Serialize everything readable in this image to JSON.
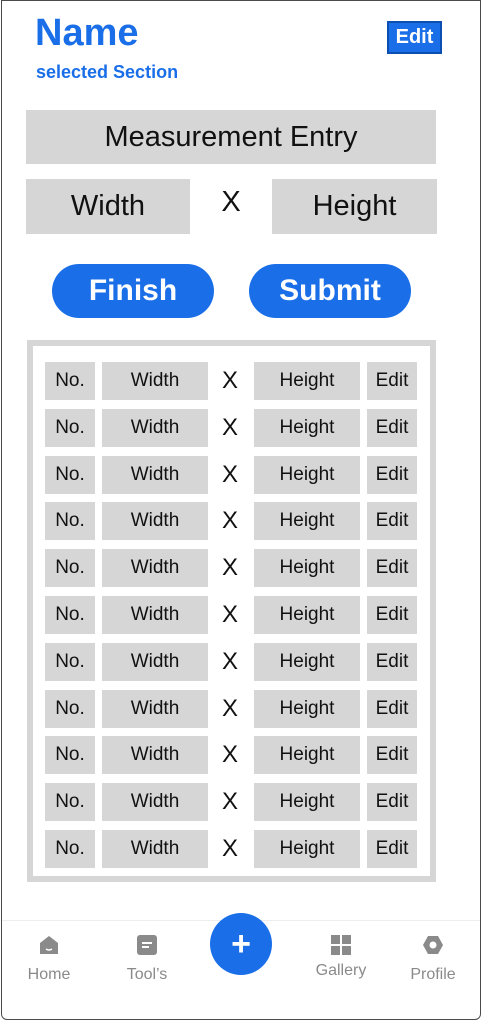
{
  "header": {
    "title": "Name",
    "subtitle": "selected Section",
    "edit_label": "Edit"
  },
  "entry": {
    "title": "Measurement Entry",
    "width_label": "Width",
    "x_label": "X",
    "height_label": "Height"
  },
  "actions": {
    "finish_label": "Finish",
    "submit_label": "Submit"
  },
  "table": {
    "rows": [
      {
        "no": "No.",
        "width": "Width",
        "x": "X",
        "height": "Height",
        "edit": "Edit"
      },
      {
        "no": "No.",
        "width": "Width",
        "x": "X",
        "height": "Height",
        "edit": "Edit"
      },
      {
        "no": "No.",
        "width": "Width",
        "x": "X",
        "height": "Height",
        "edit": "Edit"
      },
      {
        "no": "No.",
        "width": "Width",
        "x": "X",
        "height": "Height",
        "edit": "Edit"
      },
      {
        "no": "No.",
        "width": "Width",
        "x": "X",
        "height": "Height",
        "edit": "Edit"
      },
      {
        "no": "No.",
        "width": "Width",
        "x": "X",
        "height": "Height",
        "edit": "Edit"
      },
      {
        "no": "No.",
        "width": "Width",
        "x": "X",
        "height": "Height",
        "edit": "Edit"
      },
      {
        "no": "No.",
        "width": "Width",
        "x": "X",
        "height": "Height",
        "edit": "Edit"
      },
      {
        "no": "No.",
        "width": "Width",
        "x": "X",
        "height": "Height",
        "edit": "Edit"
      },
      {
        "no": "No.",
        "width": "Width",
        "x": "X",
        "height": "Height",
        "edit": "Edit"
      },
      {
        "no": "No.",
        "width": "Width",
        "x": "X",
        "height": "Height",
        "edit": "Edit"
      }
    ]
  },
  "tabbar": {
    "home": "Home",
    "tools": "Tool’s",
    "add_icon": "plus-icon",
    "gallery": "Gallery",
    "profile": "Profile"
  },
  "colors": {
    "accent": "#1a6fe8",
    "field_gray": "#d6d6d6",
    "tab_gray": "#8a8a8a"
  }
}
